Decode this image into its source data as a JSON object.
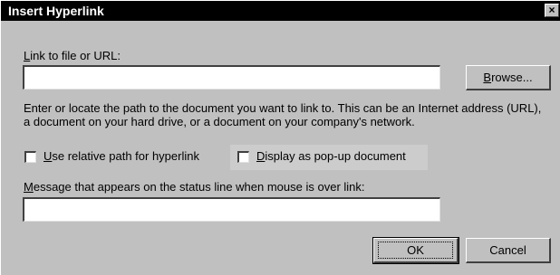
{
  "window": {
    "title": "Insert Hyperlink",
    "close_glyph": "×"
  },
  "link_field": {
    "label_accel": "L",
    "label_rest": "ink to file or URL:",
    "value": ""
  },
  "browse_button": {
    "label_accel": "B",
    "label_rest": "rowse..."
  },
  "description": "Enter or locate the path to the document you want to link to. This can be an Internet address (URL), a document on your hard drive, or a document on your company's network.",
  "relative_path": {
    "label_accel": "U",
    "label_rest": "se relative path for hyperlink",
    "checked": false
  },
  "popup_doc": {
    "label_accel": "D",
    "label_rest": "isplay as pop-up document",
    "checked": false
  },
  "status_message": {
    "label_accel": "M",
    "label_rest": "essage that appears on the status line when mouse is over link:",
    "value": ""
  },
  "ok_button": {
    "label": "OK"
  },
  "cancel_button": {
    "label": "Cancel"
  }
}
